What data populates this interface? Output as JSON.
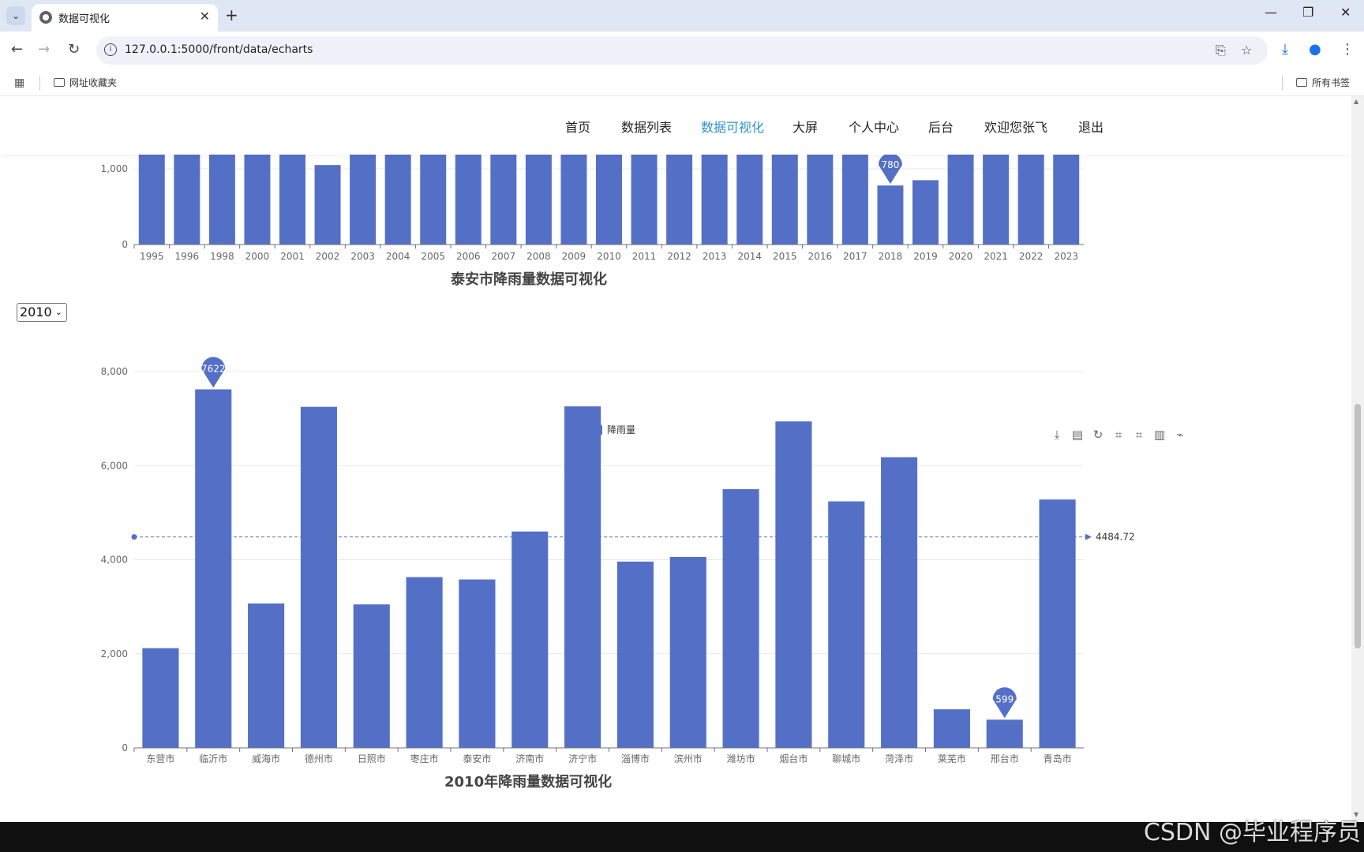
{
  "browser": {
    "tab_title": "数据可视化",
    "url": "127.0.0.1:5000/front/data/echarts",
    "bookmark_folder": "网址收藏夹",
    "all_bookmarks": "所有书签"
  },
  "nav": {
    "items": [
      "首页",
      "数据列表",
      "数据可视化",
      "大屏",
      "个人中心",
      "后台",
      "欢迎您张飞",
      "退出"
    ],
    "active": "数据可视化"
  },
  "year_select": {
    "value": "2010"
  },
  "colors": {
    "bar": "#5470c6",
    "active_nav": "#2f93d4"
  },
  "chart_data": [
    {
      "type": "bar",
      "title": "泰安市降雨量数据可视化",
      "categories": [
        "1995",
        "1996",
        "1998",
        "2000",
        "2001",
        "2002",
        "2003",
        "2004",
        "2005",
        "2006",
        "2007",
        "2008",
        "2009",
        "2010",
        "2011",
        "2012",
        "2013",
        "2014",
        "2015",
        "2016",
        "2017",
        "2018",
        "2019",
        "2020",
        "2021",
        "2022",
        "2023"
      ],
      "values": [
        1300,
        1300,
        1300,
        1300,
        1300,
        1050,
        1300,
        1300,
        1300,
        1300,
        1300,
        1300,
        1300,
        1300,
        1300,
        1300,
        1300,
        1300,
        1300,
        1300,
        1300,
        780,
        850,
        1300,
        1300,
        1300,
        1300
      ],
      "yticks": [
        0,
        1000
      ],
      "ytick_labels": [
        "0",
        "1,000"
      ],
      "markpoint": {
        "category": "2018",
        "label": "780"
      }
    },
    {
      "type": "bar",
      "title": "2010年降雨量数据可视化",
      "legend": "降雨量",
      "categories": [
        "东营市",
        "临沂市",
        "威海市",
        "德州市",
        "日照市",
        "枣庄市",
        "泰安市",
        "济南市",
        "济宁市",
        "淄博市",
        "滨州市",
        "潍坊市",
        "烟台市",
        "聊城市",
        "菏泽市",
        "莱芜市",
        "邢台市",
        "青岛市"
      ],
      "values": [
        2120,
        7622,
        3070,
        7250,
        3050,
        3630,
        3580,
        4600,
        7260,
        3960,
        4060,
        5500,
        6940,
        5240,
        6180,
        820,
        599,
        5280
      ],
      "ylim": [
        0,
        8000
      ],
      "yticks": [
        0,
        2000,
        4000,
        6000,
        8000
      ],
      "ytick_labels": [
        "0",
        "2,000",
        "4,000",
        "6,000",
        "8,000"
      ],
      "markpoints": [
        {
          "category": "临沂市",
          "label": "7622"
        },
        {
          "category": "邢台市",
          "label": "599"
        }
      ],
      "markline": {
        "value": 4484.72,
        "label": "4484.72"
      },
      "grid": true,
      "legend_position": "top-center"
    }
  ],
  "watermark": "CSDN @毕业程序员"
}
